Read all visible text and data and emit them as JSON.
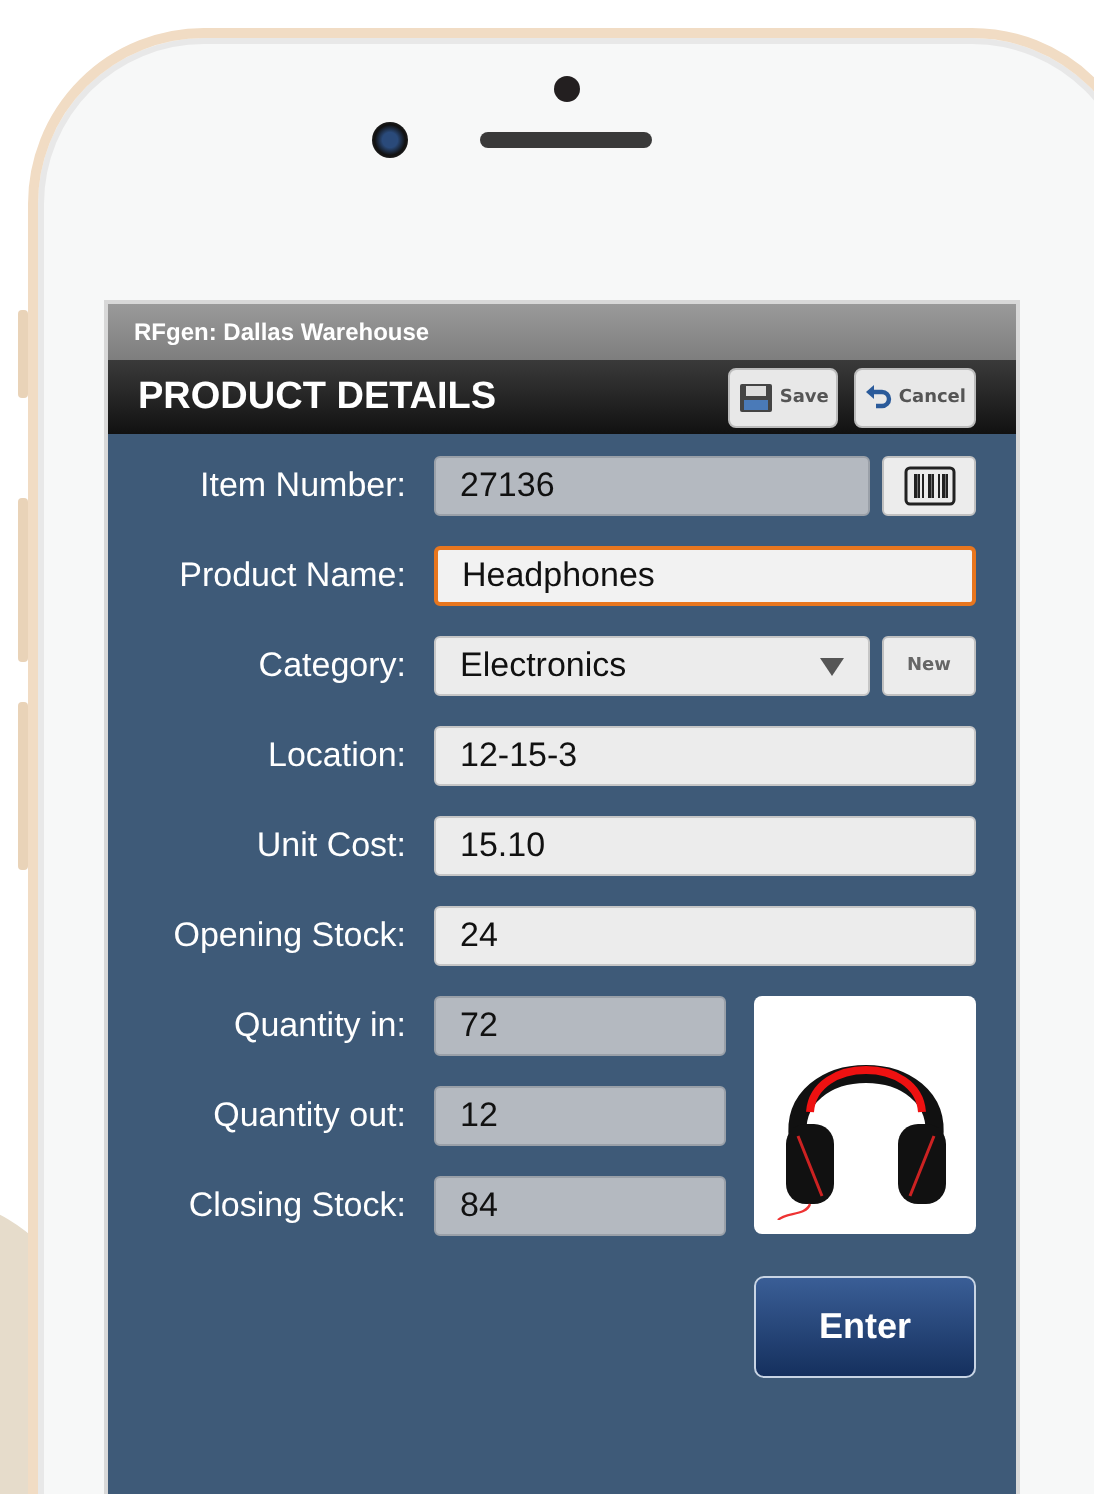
{
  "window": {
    "title": "RFgen: Dallas Warehouse"
  },
  "header": {
    "title": "PRODUCT DETAILS",
    "buttons": [
      {
        "label": "Save",
        "kind": "save"
      },
      {
        "label": "Cancel",
        "kind": "cancel"
      }
    ]
  },
  "fields": [
    {
      "label": "Item Number:",
      "value": "27136",
      "kind": "readonly",
      "focused": false,
      "action": {
        "kind": "scan"
      }
    },
    {
      "label": "Product Name:",
      "value": "Headphones",
      "kind": "input",
      "focused": true
    },
    {
      "label": "Category:",
      "value": "Electronics",
      "kind": "dropdown",
      "focused": false,
      "action": {
        "kind": "text",
        "label": "New"
      }
    },
    {
      "label": "Location:",
      "value": "12-15-3",
      "kind": "input",
      "focused": false
    },
    {
      "label": "Unit Cost:",
      "value": "15.10",
      "kind": "input",
      "focused": false
    },
    {
      "label": "Opening Stock:",
      "value": "24",
      "kind": "input",
      "focused": false
    }
  ],
  "stock_fields": [
    {
      "label": "Quantity in:",
      "value": "72",
      "kind": "readonly"
    },
    {
      "label": "Quantity out:",
      "value": "12",
      "kind": "readonly"
    },
    {
      "label": "Closing Stock:",
      "value": "84",
      "kind": "readonly"
    }
  ],
  "enter_button": {
    "label": "Enter"
  }
}
